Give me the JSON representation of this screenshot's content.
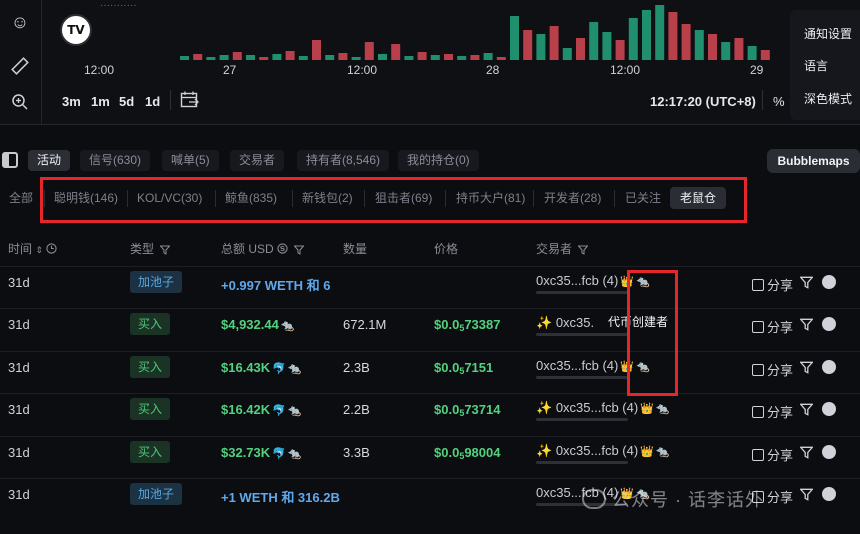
{
  "chart": {
    "top_cut_text": "···········",
    "x_ticks": [
      "12:00",
      "27",
      "12:00",
      "28",
      "12:00",
      "29"
    ],
    "timeframes": [
      "3m",
      "1m",
      "5d",
      "1d"
    ],
    "time_readout": "12:17:20 (UTC+8)",
    "pct_label": "%",
    "logo": "TV",
    "volume_bars": [
      {
        "v": 4,
        "c": "g"
      },
      {
        "v": 6,
        "c": "r"
      },
      {
        "v": 3,
        "c": "g"
      },
      {
        "v": 5,
        "c": "g"
      },
      {
        "v": 8,
        "c": "r"
      },
      {
        "v": 5,
        "c": "g"
      },
      {
        "v": 3,
        "c": "r"
      },
      {
        "v": 6,
        "c": "g"
      },
      {
        "v": 9,
        "c": "r"
      },
      {
        "v": 4,
        "c": "g"
      },
      {
        "v": 20,
        "c": "r"
      },
      {
        "v": 5,
        "c": "g"
      },
      {
        "v": 7,
        "c": "r"
      },
      {
        "v": 3,
        "c": "g"
      },
      {
        "v": 18,
        "c": "r"
      },
      {
        "v": 6,
        "c": "g"
      },
      {
        "v": 16,
        "c": "r"
      },
      {
        "v": 4,
        "c": "g"
      },
      {
        "v": 8,
        "c": "r"
      },
      {
        "v": 5,
        "c": "g"
      },
      {
        "v": 6,
        "c": "r"
      },
      {
        "v": 4,
        "c": "g"
      },
      {
        "v": 5,
        "c": "r"
      },
      {
        "v": 7,
        "c": "g"
      },
      {
        "v": 3,
        "c": "r"
      },
      {
        "v": 44,
        "c": "g"
      },
      {
        "v": 30,
        "c": "r"
      },
      {
        "v": 26,
        "c": "g"
      },
      {
        "v": 34,
        "c": "r"
      },
      {
        "v": 12,
        "c": "g"
      },
      {
        "v": 22,
        "c": "r"
      },
      {
        "v": 38,
        "c": "g"
      },
      {
        "v": 28,
        "c": "g"
      },
      {
        "v": 20,
        "c": "r"
      },
      {
        "v": 42,
        "c": "g"
      },
      {
        "v": 50,
        "c": "g"
      },
      {
        "v": 55,
        "c": "g"
      },
      {
        "v": 48,
        "c": "r"
      },
      {
        "v": 36,
        "c": "r"
      },
      {
        "v": 30,
        "c": "g"
      },
      {
        "v": 26,
        "c": "r"
      },
      {
        "v": 18,
        "c": "g"
      },
      {
        "v": 22,
        "c": "r"
      },
      {
        "v": 14,
        "c": "g"
      },
      {
        "v": 10,
        "c": "r"
      }
    ]
  },
  "settings_menu": [
    "通知设置",
    "语言",
    "深色模式"
  ],
  "tabs_row1": [
    {
      "label": "活动",
      "active": true
    },
    {
      "label": "信号(630)"
    },
    {
      "label": "喊单(5)"
    },
    {
      "label": "交易者"
    },
    {
      "label": "持有者(8,546)"
    },
    {
      "label": "我的持仓(0)"
    }
  ],
  "bubblemaps_label": "Bubblemaps",
  "tabs_row2": [
    {
      "label": "全部"
    },
    {
      "label": "聪明钱(146)"
    },
    {
      "label": "KOL/VC(30)"
    },
    {
      "label": "鲸鱼(835)"
    },
    {
      "label": "新钱包(2)"
    },
    {
      "label": "狙击者(69)"
    },
    {
      "label": "持币大户(81)"
    },
    {
      "label": "开发者(28)"
    },
    {
      "label": "已关注"
    },
    {
      "label": "老鼠仓",
      "active": true
    }
  ],
  "table": {
    "headers": {
      "time": "时间",
      "type": "类型",
      "total": "总额 USD",
      "qty": "数量",
      "price": "价格",
      "trader": "交易者"
    },
    "rows": [
      {
        "time": "31d",
        "type": "加池子",
        "kind": "add",
        "amount": "+0.997 WETH 和 6",
        "qty": "",
        "price_pre": "",
        "price_sub": "",
        "price_post": "",
        "trader": "0xc35...fcb (4)",
        "spark": false
      },
      {
        "time": "31d",
        "type": "买入",
        "kind": "buy",
        "amount": "$4,932.44",
        "qty": "672.1M",
        "price_pre": "$0.0",
        "price_sub": "5",
        "price_post": "73387",
        "trader": "0xc35.",
        "spark": true
      },
      {
        "time": "31d",
        "type": "买入",
        "kind": "buy",
        "amount": "$16.43K",
        "qty": "2.3B",
        "price_pre": "$0.0",
        "price_sub": "5",
        "price_post": "7151",
        "trader": "0xc35...fcb (4)",
        "spark": false
      },
      {
        "time": "31d",
        "type": "买入",
        "kind": "buy",
        "amount": "$16.42K",
        "qty": "2.2B",
        "price_pre": "$0.0",
        "price_sub": "5",
        "price_post": "73714",
        "trader": "0xc35...fcb (4)",
        "spark": true
      },
      {
        "time": "31d",
        "type": "买入",
        "kind": "buy",
        "amount": "$32.73K",
        "qty": "3.3B",
        "price_pre": "$0.0",
        "price_sub": "5",
        "price_post": "98004",
        "trader": "0xc35...fcb (4)",
        "spark": true
      },
      {
        "time": "31d",
        "type": "加池子",
        "kind": "add",
        "amount": "+1 WETH 和 316.2B",
        "qty": "",
        "price_pre": "",
        "price_sub": "",
        "price_post": "",
        "trader": "0xc35...fcb (4)",
        "spark": false
      }
    ],
    "share_label": "分享",
    "tooltip_partial": "代币",
    "tooltip": "创建者"
  },
  "watermark": "公众号 · 话李话外",
  "colors": {
    "green": "#1f8f6e",
    "red": "#b8404a",
    "accent_red_box": "#e5262b"
  }
}
